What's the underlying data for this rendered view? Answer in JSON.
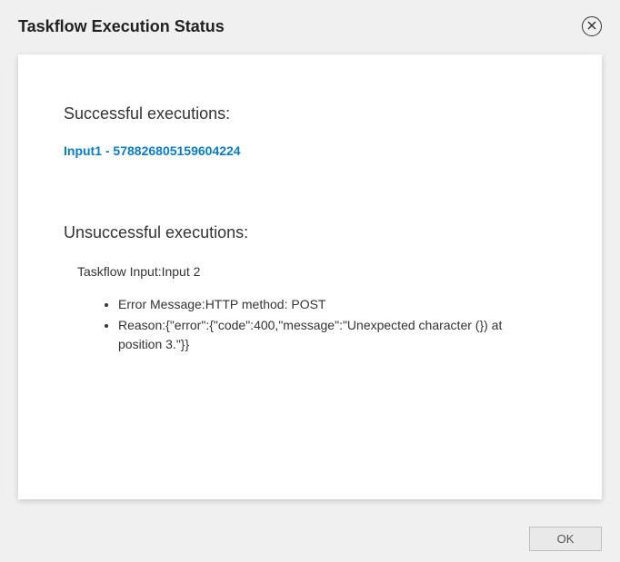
{
  "header": {
    "title": "Taskflow Execution Status"
  },
  "success": {
    "heading": "Successful executions:",
    "link_text": "Input1 - 578826805159604224"
  },
  "unsuccessful": {
    "heading": "Unsuccessful executions:",
    "input_label": "Taskflow Input:Input 2",
    "error_message": "Error Message:HTTP method: POST",
    "reason": "Reason:{\"error\":{\"code\":400,\"message\":\"Unexpected character (}) at position 3.\"}}"
  },
  "footer": {
    "ok_label": "OK"
  }
}
